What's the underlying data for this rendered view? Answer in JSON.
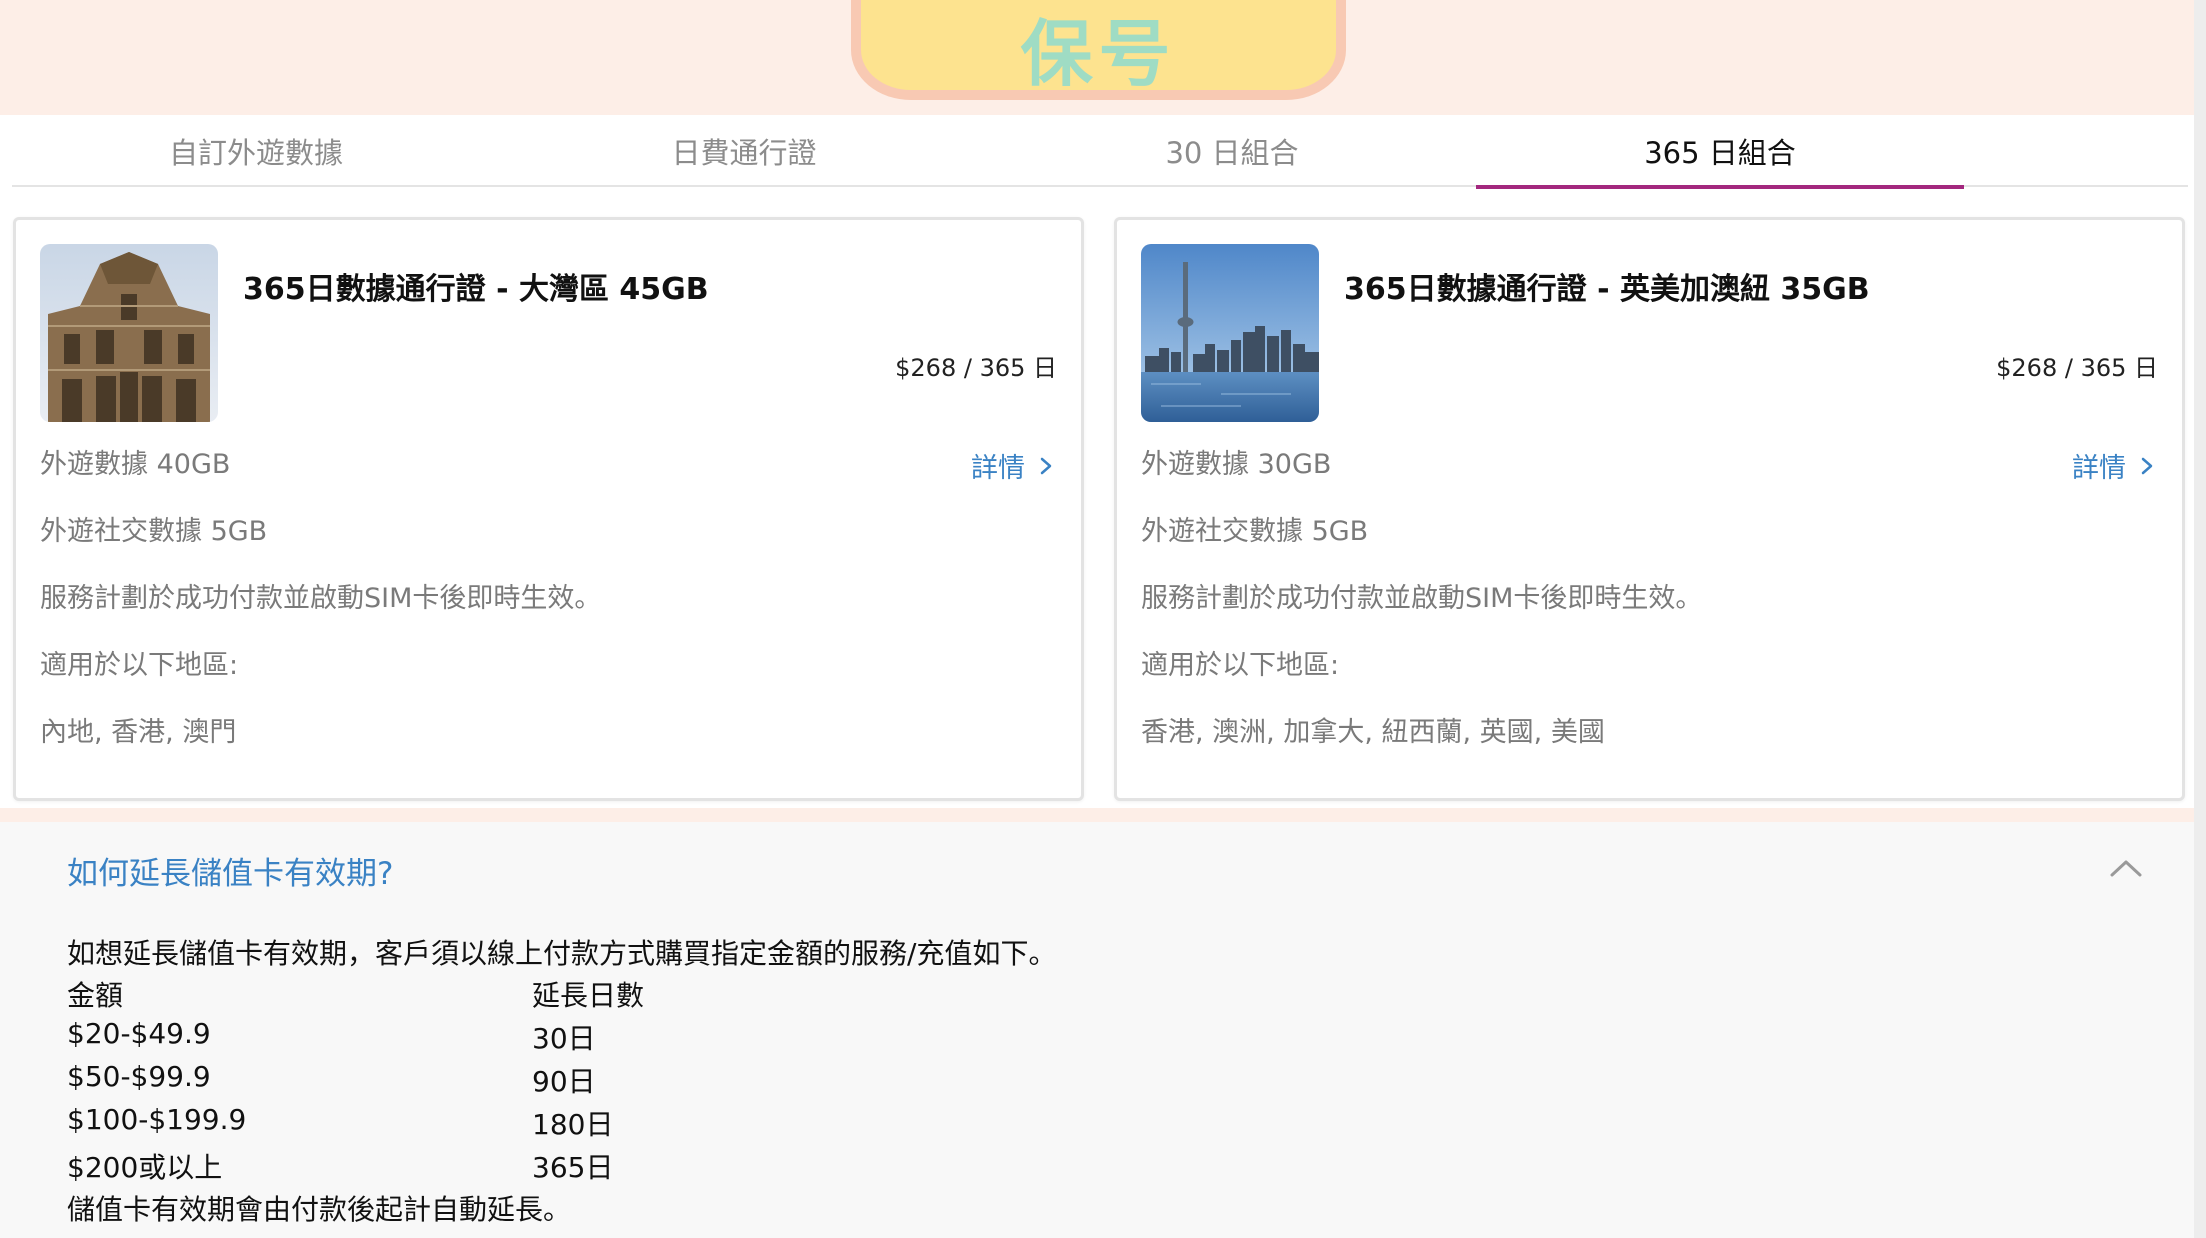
{
  "brand": {
    "logo_text": "保号"
  },
  "tabs": [
    {
      "label": "自訂外遊數據",
      "active": false
    },
    {
      "label": "日費通行證",
      "active": false
    },
    {
      "label": "30 日組合",
      "active": false
    },
    {
      "label": "365 日組合",
      "active": true
    }
  ],
  "colors": {
    "accent": "#a3277e",
    "link": "#3a82c4",
    "header_bg": "#fdeee7",
    "logo_fill": "#fde38f"
  },
  "plans": [
    {
      "image": "ruins-of-st-paul-photo",
      "title": "365日數據通行證 - 大灣區 45GB",
      "price": "$268 / 365 日",
      "details_label": "詳情",
      "lines": [
        "外遊數據 40GB",
        "外遊社交數據 5GB",
        "服務計劃於成功付款並啟動SIM卡後即時生效。",
        "適用於以下地區:",
        "內地, 香港, 澳門"
      ]
    },
    {
      "image": "toronto-skyline-photo",
      "title": "365日數據通行證 - 英美加澳紐 35GB",
      "price": "$268 / 365 日",
      "details_label": "詳情",
      "lines": [
        "外遊數據 30GB",
        "外遊社交數據 5GB",
        "服務計劃於成功付款並啟動SIM卡後即時生效。",
        "適用於以下地區:",
        "香港, 澳洲, 加拿大, 紐西蘭, 英國, 美國"
      ]
    }
  ],
  "faq": {
    "question": "如何延長儲值卡有效期?",
    "expanded": true,
    "intro": "如想延長儲值卡有效期，客戶須以線上付款方式購買指定金額的服務/充值如下。",
    "table_headers": [
      "金額",
      "延長日數"
    ],
    "rows": [
      [
        "$20-$49.9",
        "30日"
      ],
      [
        "$50-$99.9",
        "90日"
      ],
      [
        "$100-$199.9",
        "180日"
      ],
      [
        "$200或以上",
        "365日"
      ]
    ],
    "footer": "儲值卡有效期會由付款後起計自動延長。"
  }
}
